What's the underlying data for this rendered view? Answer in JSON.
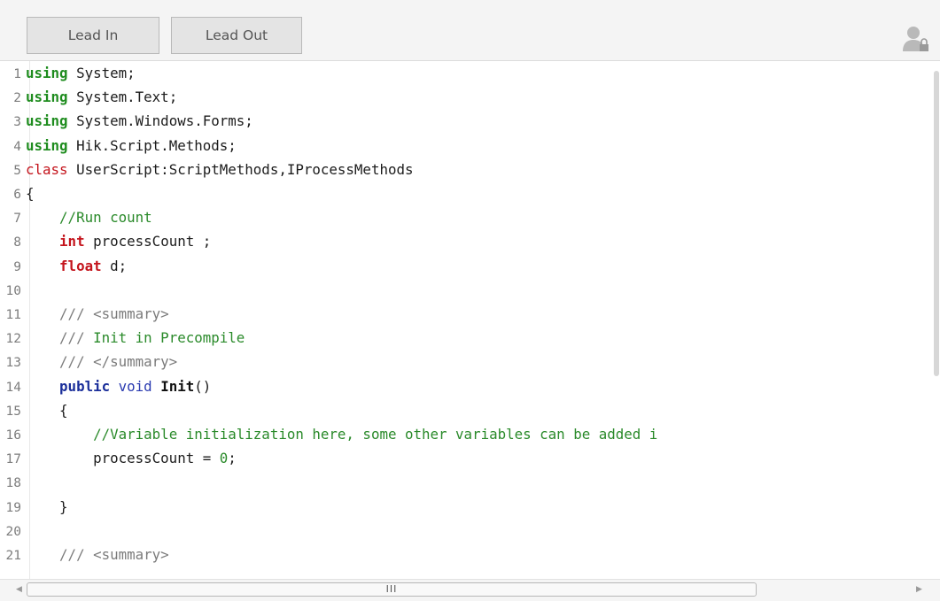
{
  "toolbar": {
    "lead_in_label": "Lead In",
    "lead_out_label": "Lead Out",
    "user_icon": "user-lock-icon"
  },
  "editor": {
    "lines": [
      {
        "n": "1",
        "segs": [
          [
            "kw-green",
            "using"
          ],
          [
            "code",
            " System;"
          ]
        ]
      },
      {
        "n": "2",
        "segs": [
          [
            "kw-green",
            "using"
          ],
          [
            "code",
            " System.Text;"
          ]
        ]
      },
      {
        "n": "3",
        "segs": [
          [
            "kw-green",
            "using"
          ],
          [
            "code",
            " System.Windows.Forms;"
          ]
        ]
      },
      {
        "n": "4",
        "segs": [
          [
            "kw-green",
            "using"
          ],
          [
            "code",
            " Hik.Script.Methods;"
          ]
        ]
      },
      {
        "n": "5",
        "segs": [
          [
            "kw-red",
            "class"
          ],
          [
            "code",
            " UserScript:ScriptMethods,IProcessMethods"
          ]
        ]
      },
      {
        "n": "6",
        "segs": [
          [
            "code",
            "{"
          ]
        ]
      },
      {
        "n": "7",
        "segs": [
          [
            "code",
            "    "
          ],
          [
            "cmt",
            "//Run count"
          ]
        ]
      },
      {
        "n": "8",
        "segs": [
          [
            "code",
            "    "
          ],
          [
            "kw-red-b",
            "int"
          ],
          [
            "code",
            " processCount ;"
          ]
        ]
      },
      {
        "n": "9",
        "segs": [
          [
            "code",
            "    "
          ],
          [
            "kw-red-b",
            "float"
          ],
          [
            "code",
            " d;"
          ]
        ]
      },
      {
        "n": "10",
        "segs": []
      },
      {
        "n": "11",
        "segs": [
          [
            "code",
            "    "
          ],
          [
            "xml",
            "/// <summary>"
          ]
        ]
      },
      {
        "n": "12",
        "segs": [
          [
            "code",
            "    "
          ],
          [
            "xml",
            "/// "
          ],
          [
            "cmt",
            "Init in Precompile"
          ]
        ]
      },
      {
        "n": "13",
        "segs": [
          [
            "code",
            "    "
          ],
          [
            "xml",
            "/// </summary>"
          ]
        ]
      },
      {
        "n": "14",
        "segs": [
          [
            "code",
            "    "
          ],
          [
            "kw-blue",
            "public"
          ],
          [
            "code",
            " "
          ],
          [
            "kw-blue-n",
            "void"
          ],
          [
            "code",
            " "
          ],
          [
            "fn-b",
            "Init"
          ],
          [
            "code",
            "()"
          ]
        ]
      },
      {
        "n": "15",
        "segs": [
          [
            "code",
            "    {"
          ]
        ]
      },
      {
        "n": "16",
        "segs": [
          [
            "code",
            "        "
          ],
          [
            "cmt",
            "//Variable initialization here, some other variables can be added i"
          ]
        ]
      },
      {
        "n": "17",
        "segs": [
          [
            "code",
            "        processCount = "
          ],
          [
            "num",
            "0"
          ],
          [
            "code",
            ";"
          ]
        ]
      },
      {
        "n": "18",
        "segs": []
      },
      {
        "n": "19",
        "segs": [
          [
            "code",
            "    }"
          ]
        ]
      },
      {
        "n": "20",
        "segs": []
      },
      {
        "n": "21",
        "segs": [
          [
            "code",
            "    "
          ],
          [
            "xml",
            "/// <summary>"
          ]
        ]
      }
    ]
  },
  "scrollbar": {
    "thumb_grip": "III"
  }
}
